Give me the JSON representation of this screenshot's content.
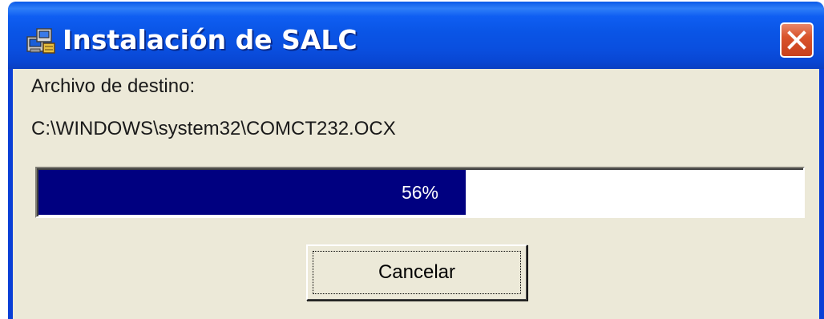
{
  "window": {
    "title": "Instalación de SALC",
    "app_icon": "setup-computer-icon",
    "close_icon": "close-icon"
  },
  "content": {
    "label": "Archivo de destino:",
    "path": "C:\\WINDOWS\\system32\\COMCT232.OCX"
  },
  "progress": {
    "value": 0.56,
    "text": "56%"
  },
  "buttons": {
    "cancel_label": "Cancelar"
  },
  "colors": {
    "titlebar": "#0a55e6",
    "client_bg": "#ece9d8",
    "progress_fill": "#000080",
    "close_button": "#d9542b"
  }
}
